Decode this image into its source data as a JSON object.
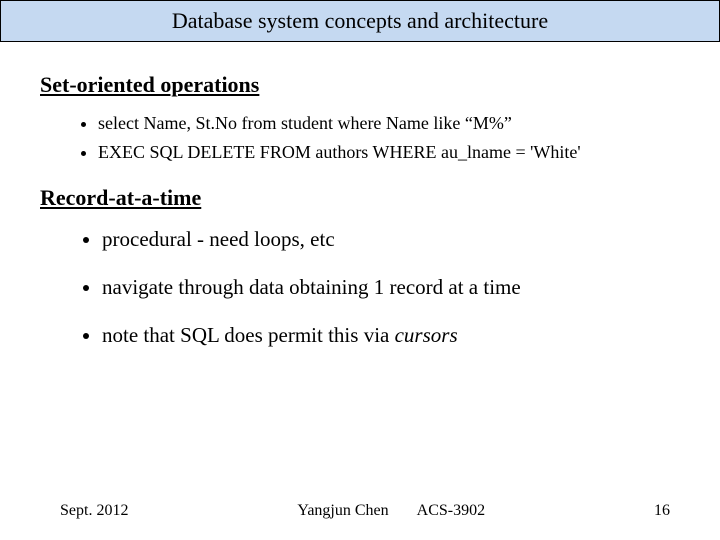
{
  "title": "Database system concepts and architecture",
  "sections": {
    "set_oriented": {
      "heading": "Set-oriented operations",
      "items": [
        "select Name, St.No from student where Name like “M%”",
        "EXEC SQL DELETE FROM authors WHERE au_lname = 'White'"
      ]
    },
    "record_at_a_time": {
      "heading": "Record-at-a-time",
      "items": [
        {
          "pre": "procedural - need loops, etc",
          "em": ""
        },
        {
          "pre": "navigate through data obtaining 1 record at a time",
          "em": ""
        },
        {
          "pre": "note that SQL does permit this via ",
          "em": "cursors"
        }
      ]
    }
  },
  "footer": {
    "date": "Sept. 2012",
    "author": "Yangjun Chen",
    "course": "ACS-3902",
    "page": "16"
  }
}
